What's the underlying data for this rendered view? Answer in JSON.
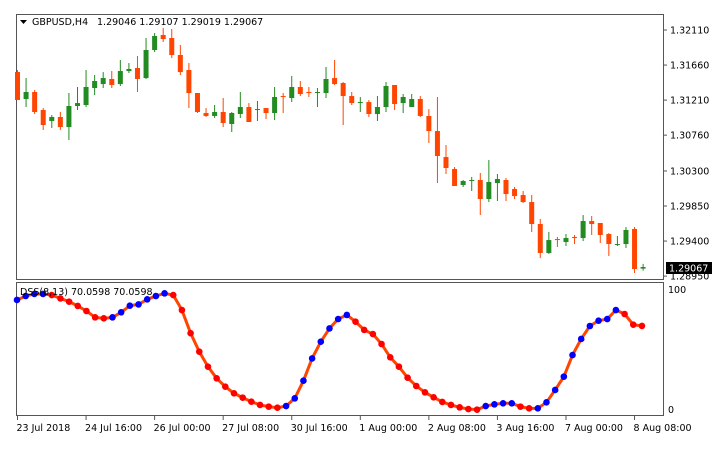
{
  "header": {
    "symbol": "GBPUSD,H4",
    "ohlc": "1.29046 1.29107 1.29019 1.29067"
  },
  "colors": {
    "bull": "#228B22",
    "bear": "#FF4500",
    "dss_line": "#FF4500",
    "dss_up": "#0000FF",
    "dss_down": "#FF0000",
    "frame": "#555555"
  },
  "chart_data": [
    {
      "type": "candlestick",
      "title": "GBPUSD,H4",
      "ylim": [
        1.2895,
        1.3221
      ],
      "y_ticks": [
        "1.32110",
        "1.31660",
        "1.31210",
        "1.30760",
        "1.30300",
        "1.29850",
        "1.29400",
        "1.28950"
      ],
      "current_price_label": "1.29067",
      "x_ticks": [
        "23 Jul 2018",
        "24 Jul 16:00",
        "26 Jul 00:00",
        "27 Jul 08:00",
        "30 Jul 16:00",
        "1 Aug 00:00",
        "2 Aug 08:00",
        "3 Aug 16:00",
        "7 Aug 00:00",
        "8 Aug 08:00"
      ],
      "x_tick_every_bars": 8,
      "ohlc": [
        [
          1.3157,
          1.31596,
          1.31211,
          1.31211
        ],
        [
          1.31224,
          1.31493,
          1.31121,
          1.31314
        ],
        [
          1.31314,
          1.3134,
          1.31031,
          1.31057
        ],
        [
          1.31083,
          1.31108,
          1.30826,
          1.3089
        ],
        [
          1.30941,
          1.31018,
          1.30852,
          1.30993
        ],
        [
          1.30993,
          1.31057,
          1.30826,
          1.30864
        ],
        [
          1.30864,
          1.31301,
          1.30697,
          1.31134
        ],
        [
          1.31134,
          1.31378,
          1.31083,
          1.31172
        ],
        [
          1.31147,
          1.31596,
          1.31121,
          1.31378
        ],
        [
          1.31365,
          1.31532,
          1.31275,
          1.31455
        ],
        [
          1.31416,
          1.3157,
          1.31365,
          1.31493
        ],
        [
          1.31481,
          1.31583,
          1.31365,
          1.31404
        ],
        [
          1.31416,
          1.31725,
          1.31391,
          1.31583
        ],
        [
          1.31583,
          1.31686,
          1.31558,
          1.31609
        ],
        [
          1.31622,
          1.31776,
          1.31314,
          1.31481
        ],
        [
          1.31493,
          1.32007,
          1.31481,
          1.31853
        ],
        [
          1.31853,
          1.32071,
          1.31827,
          1.32033
        ],
        [
          1.32046,
          1.32135,
          1.31956,
          1.31994
        ],
        [
          1.32007,
          1.32123,
          1.3175,
          1.31789
        ],
        [
          1.31789,
          1.31917,
          1.31532,
          1.3157
        ],
        [
          1.31596,
          1.31686,
          1.31108,
          1.31301
        ],
        [
          1.31301,
          1.31301,
          1.31044,
          1.31057
        ],
        [
          1.31044,
          1.31108,
          1.30993,
          1.31006
        ],
        [
          1.31006,
          1.31147,
          1.3098,
          1.31057
        ],
        [
          1.31057,
          1.31237,
          1.30864,
          1.30916
        ],
        [
          1.30903,
          1.31057,
          1.308,
          1.31044
        ],
        [
          1.31031,
          1.31314,
          1.3098,
          1.31121
        ],
        [
          1.31121,
          1.31172,
          1.30929,
          1.30929
        ],
        [
          1.31083,
          1.31198,
          1.30941,
          1.31095
        ],
        [
          1.31108,
          1.31108,
          1.30967,
          1.31044
        ],
        [
          1.31044,
          1.31378,
          1.30954,
          1.3125
        ],
        [
          1.31262,
          1.31301,
          1.31044,
          1.3125
        ],
        [
          1.31237,
          1.31519,
          1.31185,
          1.31378
        ],
        [
          1.31378,
          1.31455,
          1.31262,
          1.31288
        ],
        [
          1.31314,
          1.31378,
          1.3125,
          1.31301
        ],
        [
          1.31301,
          1.31365,
          1.31121,
          1.31314
        ],
        [
          1.31301,
          1.31635,
          1.31237,
          1.31481
        ],
        [
          1.31493,
          1.31725,
          1.31404,
          1.31416
        ],
        [
          1.31429,
          1.31442,
          1.3089,
          1.31262
        ],
        [
          1.31262,
          1.31314,
          1.31147,
          1.31172
        ],
        [
          1.31172,
          1.3125,
          1.31057,
          1.31185
        ],
        [
          1.31185,
          1.31211,
          1.30993,
          1.31031
        ],
        [
          1.31031,
          1.31262,
          1.30941,
          1.31121
        ],
        [
          1.31121,
          1.31442,
          1.31057,
          1.31391
        ],
        [
          1.31404,
          1.31404,
          1.31083,
          1.3116
        ],
        [
          1.31172,
          1.31288,
          1.31044,
          1.3125
        ],
        [
          1.31121,
          1.31288,
          1.31121,
          1.31224
        ],
        [
          1.31224,
          1.31262,
          1.30993,
          1.31006
        ],
        [
          1.31006,
          1.31095,
          1.30659,
          1.30813
        ],
        [
          1.30813,
          1.3125,
          1.30145,
          1.30492
        ],
        [
          1.30479,
          1.30633,
          1.30261,
          1.30338
        ],
        [
          1.30325,
          1.3035,
          1.30107,
          1.30107
        ],
        [
          1.3012,
          1.30184,
          1.30094,
          1.30171
        ],
        [
          1.30171,
          1.30223,
          1.30043,
          1.30184
        ],
        [
          1.30184,
          1.30274,
          1.29734,
          1.2994
        ],
        [
          1.2994,
          1.3044,
          1.29901,
          1.30158
        ],
        [
          1.30145,
          1.30261,
          1.29914,
          1.30197
        ],
        [
          1.30184,
          1.3021,
          1.29914,
          1.30004
        ],
        [
          1.30068,
          1.30094,
          1.2994,
          1.29978
        ],
        [
          1.29991,
          1.30043,
          1.29888,
          1.29901
        ],
        [
          1.29901,
          1.29991,
          1.29516,
          1.29619
        ],
        [
          1.29619,
          1.29683,
          1.29182,
          1.29247
        ],
        [
          1.29247,
          1.29516,
          1.29234,
          1.29413
        ],
        [
          1.29426,
          1.29452,
          1.29324,
          1.29413
        ],
        [
          1.29388,
          1.2949,
          1.29336,
          1.29439
        ],
        [
          1.29452,
          1.29478,
          1.29362,
          1.29439
        ],
        [
          1.29439,
          1.29734,
          1.294,
          1.29657
        ],
        [
          1.29657,
          1.29721,
          1.29478,
          1.29619
        ],
        [
          1.29632,
          1.29632,
          1.29375,
          1.29478
        ],
        [
          1.2949,
          1.29503,
          1.29208,
          1.29362
        ],
        [
          1.29349,
          1.29465,
          1.29336,
          1.29362
        ],
        [
          1.29362,
          1.2958,
          1.29311,
          1.29542
        ],
        [
          1.29555,
          1.2958,
          1.2899,
          1.29041
        ],
        [
          1.29046,
          1.29107,
          1.29019,
          1.29067
        ]
      ]
    },
    {
      "type": "line",
      "title": "DSS(8,13) 70.0598 70.0598",
      "ylim": [
        0,
        100
      ],
      "y_ticks": [
        "100",
        "0"
      ],
      "values": [
        91.7,
        95,
        96.7,
        96.7,
        95.8,
        93,
        90.3,
        86.7,
        82.5,
        77.2,
        76.4,
        77.2,
        81.4,
        86.9,
        88,
        92.2,
        95,
        97.2,
        95.8,
        83.3,
        64,
        48.6,
        36.1,
        26.4,
        19.4,
        13.9,
        10.3,
        6.9,
        4.2,
        2.8,
        1.9,
        3.3,
        9.7,
        24.4,
        43,
        56.9,
        68,
        75.8,
        79.2,
        73.6,
        66.7,
        63.3,
        55,
        43.9,
        36.1,
        26.9,
        20,
        14.7,
        10.6,
        6.7,
        4.2,
        2.2,
        0.8,
        0.3,
        3.3,
        4.7,
        5.6,
        5.6,
        2.8,
        1.4,
        1.4,
        6.4,
        16.7,
        27.8,
        45.8,
        59.2,
        70,
        74.4,
        75.8,
        83.3,
        80,
        71.1,
        70.06
      ]
    }
  ]
}
